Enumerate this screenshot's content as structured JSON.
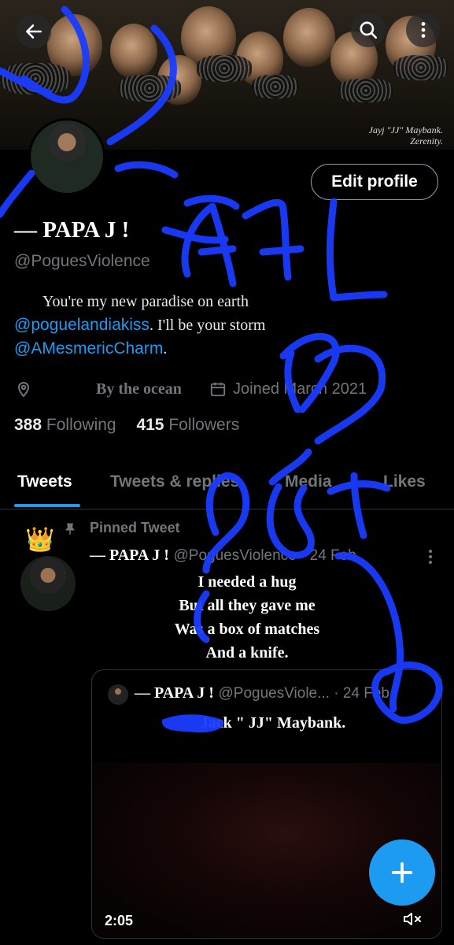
{
  "banner": {
    "signature_line1": "Jayj \"JJ\" Maybank.",
    "signature_line2": "Zerenity."
  },
  "nav": {
    "back_icon": "arrow-left-icon",
    "search_icon": "search-icon",
    "more_icon": "more-vertical-icon"
  },
  "profile": {
    "edit_label": "Edit profile",
    "name": "— PAPA J !",
    "handle": "@PoguesViolence",
    "bio_line1": "You're my new paradise on earth",
    "bio_mention1": "@poguelandiakiss",
    "bio_line2": ". I'll be your storm",
    "bio_mention2": "@AMesmericCharm",
    "bio_end": ".",
    "location": "By the ocean",
    "joined": "Joined March 2021",
    "following_count": "388",
    "following_label": "Following",
    "followers_count": "415",
    "followers_label": "Followers"
  },
  "tabs": [
    {
      "label": "Tweets"
    },
    {
      "label": "Tweets & replies"
    },
    {
      "label": "Media"
    },
    {
      "label": "Likes"
    }
  ],
  "tweet": {
    "pinned_label": "Pinned Tweet",
    "crown": "👑",
    "name": "— PAPA J !",
    "handle_time": "@PoguesViolence · 24 Feb",
    "lines": [
      "I needed a hug",
      "But all they gave me",
      "Was a box of matches",
      "And a knife."
    ],
    "quote": {
      "name": "— PAPA J !",
      "handle_time": "@PoguesViole... · 24 Feb",
      "text": "Jack \" JJ\" Maybank.",
      "video_time": "2:05"
    }
  },
  "fab_icon": "plus-icon",
  "colors": {
    "accent": "#1d9bf0",
    "background": "#000000",
    "muted": "#71767b",
    "scribble": "#1a3cff"
  }
}
